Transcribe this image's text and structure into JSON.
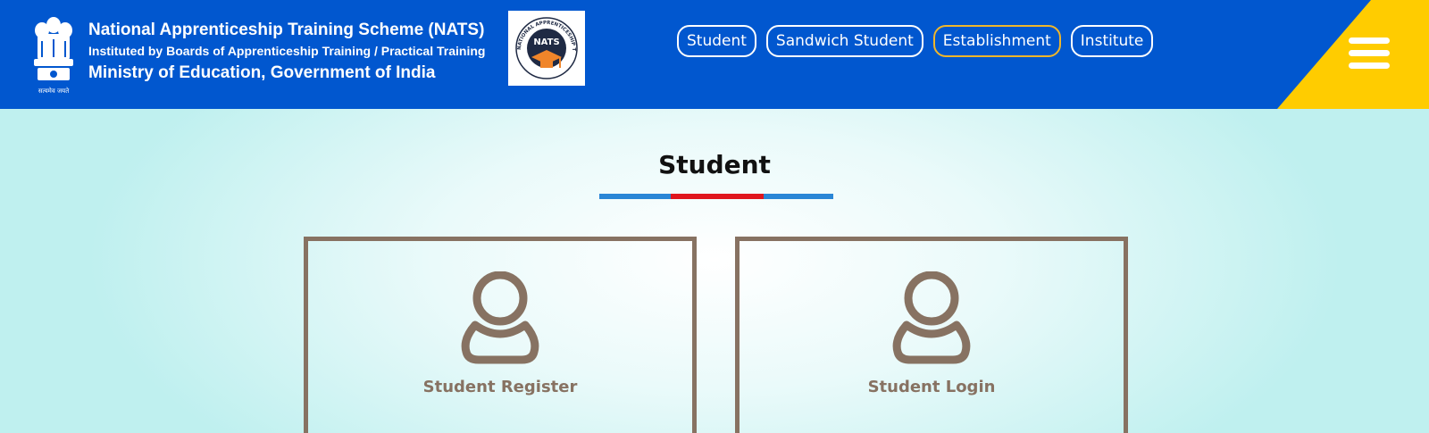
{
  "header": {
    "title": "National Apprenticeship Training Scheme (NATS)",
    "subtitle": "Instituted by Boards of Apprenticeship Training / Practical Training",
    "ministry": "Ministry of Education, Government of India",
    "emblem_motto": "सत्यमेव जयते",
    "logo_text": "NATS",
    "logo_ring_text": "NATIONAL APPRENTICESHIP TRAINING SCHEME",
    "background_color": "#0157cf",
    "accent_color": "#ffcc00"
  },
  "nav": {
    "items": [
      {
        "label": "Student",
        "active": false
      },
      {
        "label": "Sandwich Student",
        "active": false
      },
      {
        "label": "Establishment",
        "active": true
      },
      {
        "label": "Institute",
        "active": false
      }
    ],
    "menu_icon": "hamburger-menu-icon"
  },
  "main": {
    "title": "Student",
    "cards": [
      {
        "label": "Student Register",
        "icon": "user-icon"
      },
      {
        "label": "Student Login",
        "icon": "user-icon"
      }
    ],
    "card_border_color": "#877262"
  }
}
